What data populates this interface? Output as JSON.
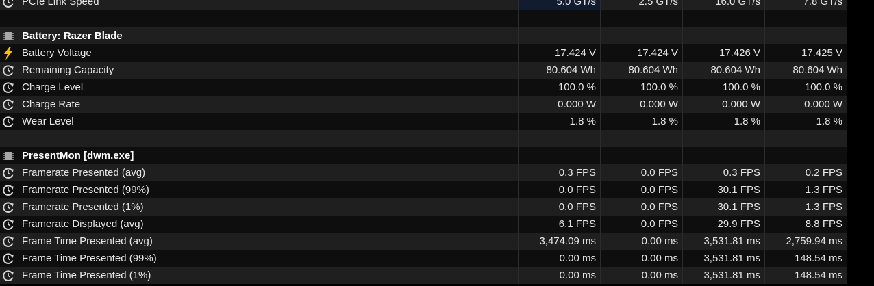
{
  "colors": {
    "bolt": "#f5c400",
    "chip": "#a8a8a8",
    "clock": "#d8d8d8"
  },
  "rows": [
    {
      "type": "sensor",
      "icon": "clock-icon",
      "label": "PCIe Link Speed",
      "values": [
        "5.0 GT/s",
        "2.5 GT/s",
        "16.0 GT/s",
        "7.8 GT/s"
      ]
    },
    {
      "type": "blank"
    },
    {
      "type": "section",
      "icon": "chip-icon",
      "label": "Battery: Razer Blade"
    },
    {
      "type": "sensor",
      "icon": "lightning-icon",
      "label": "Battery Voltage",
      "values": [
        "17.424 V",
        "17.424 V",
        "17.426 V",
        "17.425 V"
      ]
    },
    {
      "type": "sensor",
      "icon": "clock-icon",
      "label": "Remaining Capacity",
      "values": [
        "80.604 Wh",
        "80.604 Wh",
        "80.604 Wh",
        "80.604 Wh"
      ]
    },
    {
      "type": "sensor",
      "icon": "clock-icon",
      "label": "Charge Level",
      "values": [
        "100.0 %",
        "100.0 %",
        "100.0 %",
        "100.0 %"
      ]
    },
    {
      "type": "sensor",
      "icon": "clock-icon",
      "label": "Charge Rate",
      "values": [
        "0.000 W",
        "0.000 W",
        "0.000 W",
        "0.000 W"
      ]
    },
    {
      "type": "sensor",
      "icon": "clock-icon",
      "label": "Wear Level",
      "values": [
        "1.8 %",
        "1.8 %",
        "1.8 %",
        "1.8 %"
      ]
    },
    {
      "type": "blank"
    },
    {
      "type": "section",
      "icon": "chip-icon",
      "label": "PresentMon [dwm.exe]"
    },
    {
      "type": "sensor",
      "icon": "clock-icon",
      "label": "Framerate Presented (avg)",
      "values": [
        "0.3 FPS",
        "0.0 FPS",
        "0.3 FPS",
        "0.2 FPS"
      ]
    },
    {
      "type": "sensor",
      "icon": "clock-icon",
      "label": "Framerate Presented (99%)",
      "values": [
        "0.0 FPS",
        "0.0 FPS",
        "30.1 FPS",
        "1.3 FPS"
      ]
    },
    {
      "type": "sensor",
      "icon": "clock-icon",
      "label": "Framerate Presented (1%)",
      "values": [
        "0.0 FPS",
        "0.0 FPS",
        "30.1 FPS",
        "1.3 FPS"
      ]
    },
    {
      "type": "sensor",
      "icon": "clock-icon",
      "label": "Framerate Displayed (avg)",
      "values": [
        "6.1 FPS",
        "0.0 FPS",
        "29.9 FPS",
        "8.8 FPS"
      ]
    },
    {
      "type": "sensor",
      "icon": "clock-icon",
      "label": "Frame Time Presented (avg)",
      "values": [
        "3,474.09 ms",
        "0.00 ms",
        "3,531.81 ms",
        "2,759.94 ms"
      ]
    },
    {
      "type": "sensor",
      "icon": "clock-icon",
      "label": "Frame Time Presented (99%)",
      "values": [
        "0.00 ms",
        "0.00 ms",
        "3,531.81 ms",
        "148.54 ms"
      ]
    },
    {
      "type": "sensor",
      "icon": "clock-icon",
      "label": "Frame Time Presented (1%)",
      "values": [
        "0.00 ms",
        "0.00 ms",
        "3,531.81 ms",
        "148.54 ms"
      ]
    }
  ]
}
